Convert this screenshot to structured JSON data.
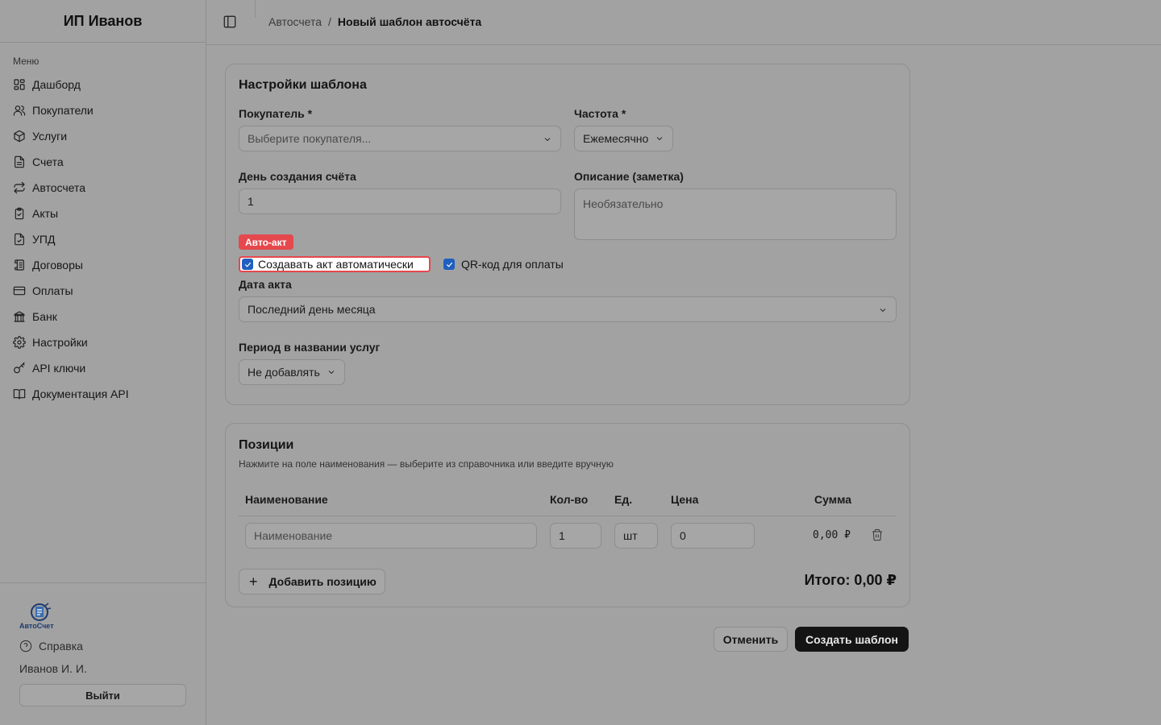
{
  "sidebar": {
    "brand": "ИП Иванов",
    "menu_label": "Меню",
    "items": [
      {
        "label": "Дашборд",
        "icon": "dashboard-icon"
      },
      {
        "label": "Покупатели",
        "icon": "users-icon"
      },
      {
        "label": "Услуги",
        "icon": "package-icon"
      },
      {
        "label": "Счета",
        "icon": "file-text-icon"
      },
      {
        "label": "Автосчета",
        "icon": "repeat-icon"
      },
      {
        "label": "Акты",
        "icon": "clipboard-check-icon"
      },
      {
        "label": "УПД",
        "icon": "file-check-icon"
      },
      {
        "label": "Договоры",
        "icon": "scroll-icon"
      },
      {
        "label": "Оплаты",
        "icon": "credit-card-icon"
      },
      {
        "label": "Банк",
        "icon": "bank-icon"
      },
      {
        "label": "Настройки",
        "icon": "gear-icon"
      },
      {
        "label": "API ключи",
        "icon": "key-icon"
      },
      {
        "label": "Документация API",
        "icon": "book-icon"
      }
    ],
    "logo_text": "АвтоСчет",
    "help_label": "Справка",
    "user_name": "Иванов И. И.",
    "logout_label": "Выйти"
  },
  "header": {
    "breadcrumb_parent": "Автосчета",
    "breadcrumb_separator": "/",
    "breadcrumb_current": "Новый шаблон автосчёта"
  },
  "settings": {
    "title": "Настройки шаблона",
    "buyer_label": "Покупатель *",
    "buyer_placeholder": "Выберите покупателя...",
    "frequency_label": "Частота *",
    "frequency_value": "Ежемесячно",
    "day_label": "День создания счёта",
    "day_value": "1",
    "description_label": "Описание (заметка)",
    "description_placeholder": "Необязательно",
    "auto_act_badge": "Авто-акт",
    "auto_act_checkbox": "Создавать акт автоматически",
    "auto_act_checked": true,
    "qr_checkbox": "QR-код для оплаты",
    "qr_checked": true,
    "act_date_label": "Дата акта",
    "act_date_value": "Последний день месяца",
    "period_label": "Период в названии услуг",
    "period_value": "Не добавлять"
  },
  "items": {
    "title": "Позиции",
    "subtitle": "Нажмите на поле наименования — выберите из справочника или введите вручную",
    "columns": {
      "name": "Наименование",
      "qty": "Кол-во",
      "unit": "Ед.",
      "price": "Цена",
      "sum": "Сумма"
    },
    "rows": [
      {
        "name_placeholder": "Наименование",
        "qty": "1",
        "unit": "шт",
        "price": "0",
        "sum": "0,00 ₽"
      }
    ],
    "add_label": "Добавить позицию",
    "total": "Итого: 0,00 ₽"
  },
  "actions": {
    "cancel_label": "Отменить",
    "create_label": "Создать шаблон"
  },
  "colors": {
    "accent_red": "#e5484d",
    "checkbox_blue": "#1f5fbf",
    "primary_button": "#141414"
  }
}
